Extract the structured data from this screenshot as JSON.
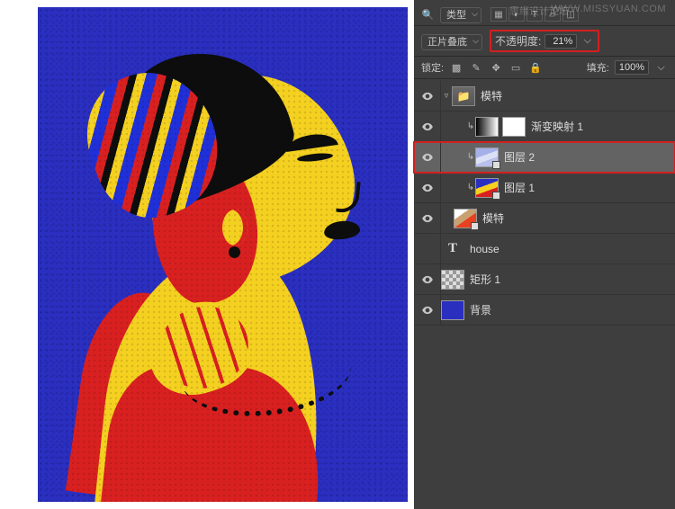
{
  "watermark_site": "WWW.MISSYUAN.COM",
  "brand_text": "思缘设计论坛",
  "filter": {
    "label": "类型"
  },
  "blend": {
    "mode": "正片叠底"
  },
  "opacity": {
    "label": "不透明度:",
    "value": "21%"
  },
  "lock": {
    "label": "锁定:",
    "fill_label": "填充:",
    "fill_value": "100%"
  },
  "layers": {
    "group": "模特",
    "grad_map": "渐变映射 1",
    "layer2": "图层 2",
    "layer1": "图层 1",
    "model": "模特",
    "text": "house",
    "rect": "矩形 1",
    "bg": "背景"
  }
}
